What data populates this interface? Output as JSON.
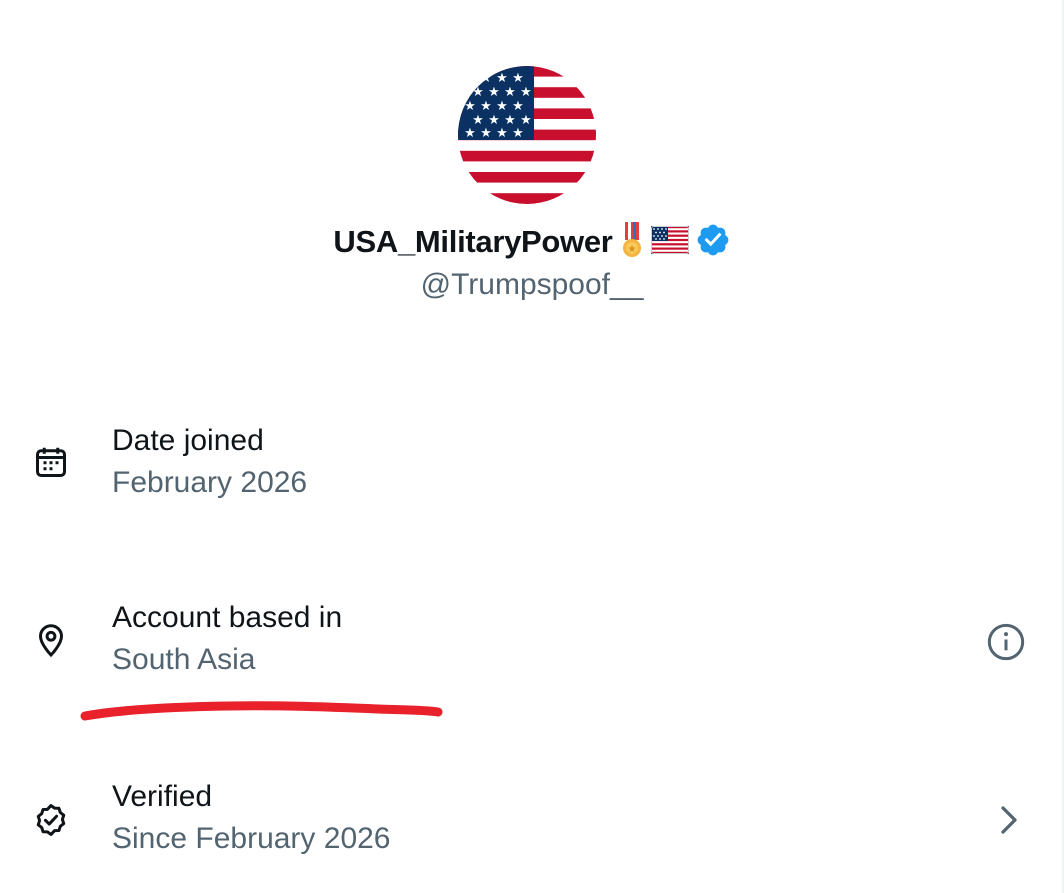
{
  "profile": {
    "display_name": "USA_MilitaryPower",
    "handle": "@Trumpspoof__",
    "avatar_icon": "us-flag-avatar",
    "name_badges": [
      "military-medal-icon",
      "us-flag-icon",
      "verified-badge-icon"
    ]
  },
  "details": [
    {
      "icon": "calendar-icon",
      "title": "Date joined",
      "value": "February 2026"
    },
    {
      "icon": "location-pin-icon",
      "title": "Account based in",
      "value": "South Asia",
      "trailing_icon": "info-icon"
    },
    {
      "icon": "verified-outline-icon",
      "title": "Verified",
      "value": "Since February 2026",
      "trailing_icon": "chevron-right-icon"
    }
  ],
  "colors": {
    "primary_text": "#0f1419",
    "secondary_text": "#536471",
    "verified_blue": "#1d9bf0",
    "annotation_red": "#e8212b",
    "flag_red": "#c8102e",
    "flag_blue": "#0a3161"
  }
}
